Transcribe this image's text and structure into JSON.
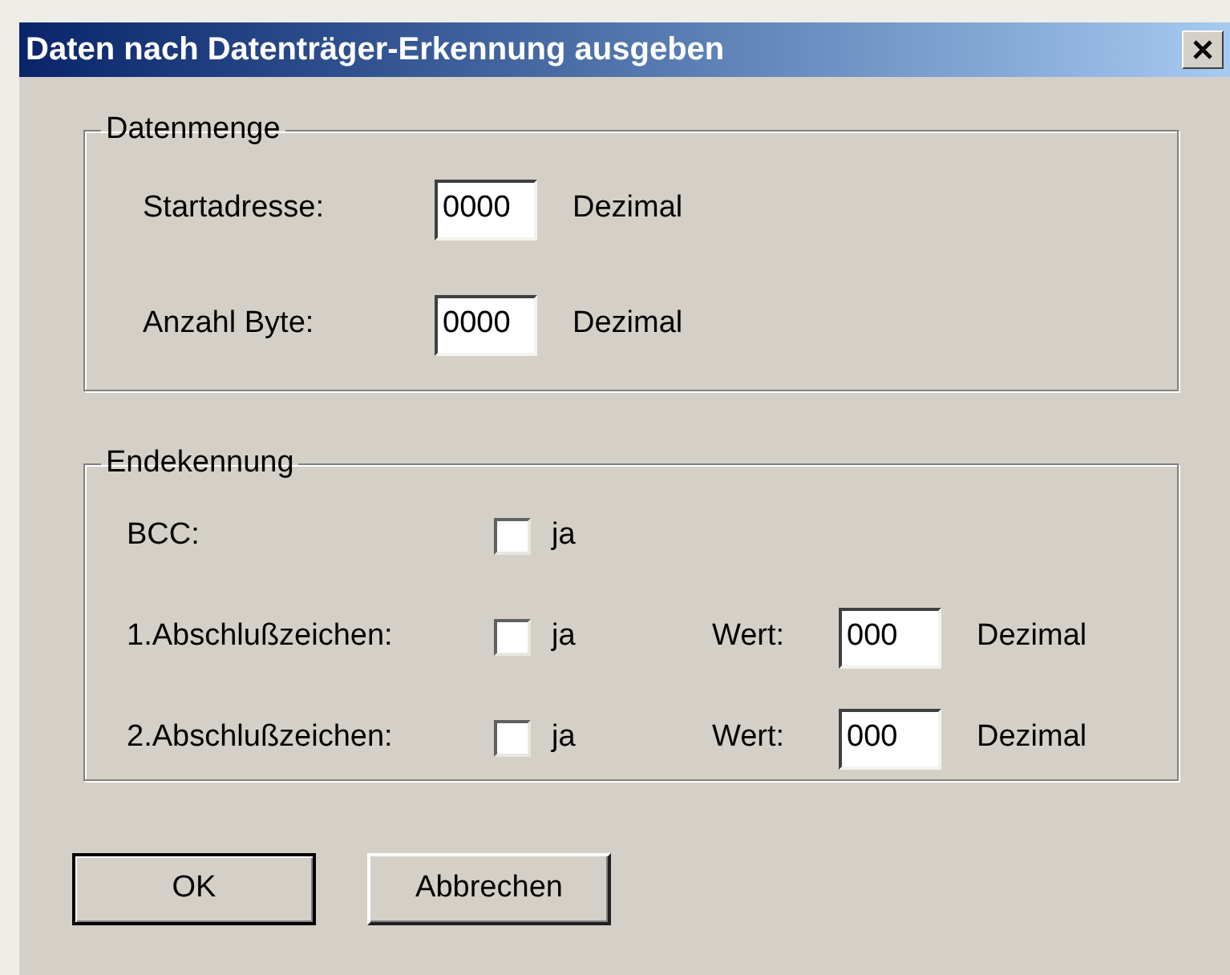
{
  "window": {
    "title": "Daten nach Datenträger-Erkennung ausgeben"
  },
  "groups": [
    {
      "title": "Datenmenge",
      "rows": [
        {
          "kind": "number",
          "label": "Startadresse:",
          "value": "0000",
          "unit": "Dezimal"
        },
        {
          "kind": "number",
          "label": "Anzahl Byte:",
          "value": "0000",
          "unit": "Dezimal"
        }
      ]
    },
    {
      "title": "Endekennung",
      "rows": [
        {
          "kind": "check",
          "label": "BCC:",
          "checkbox": {
            "label": "ja",
            "checked": false
          }
        },
        {
          "kind": "check_value",
          "label": "1.Abschlußzeichen:",
          "checkbox": {
            "label": "ja",
            "checked": false
          },
          "value_label": "Wert:",
          "value": "000",
          "unit": "Dezimal"
        },
        {
          "kind": "check_value",
          "label": "2.Abschlußzeichen:",
          "checkbox": {
            "label": "ja",
            "checked": false
          },
          "value_label": "Wert:",
          "value": "000",
          "unit": "Dezimal"
        }
      ]
    }
  ],
  "buttons": [
    {
      "label": "OK",
      "default": true
    },
    {
      "label": "Abbrechen",
      "default": false
    }
  ]
}
